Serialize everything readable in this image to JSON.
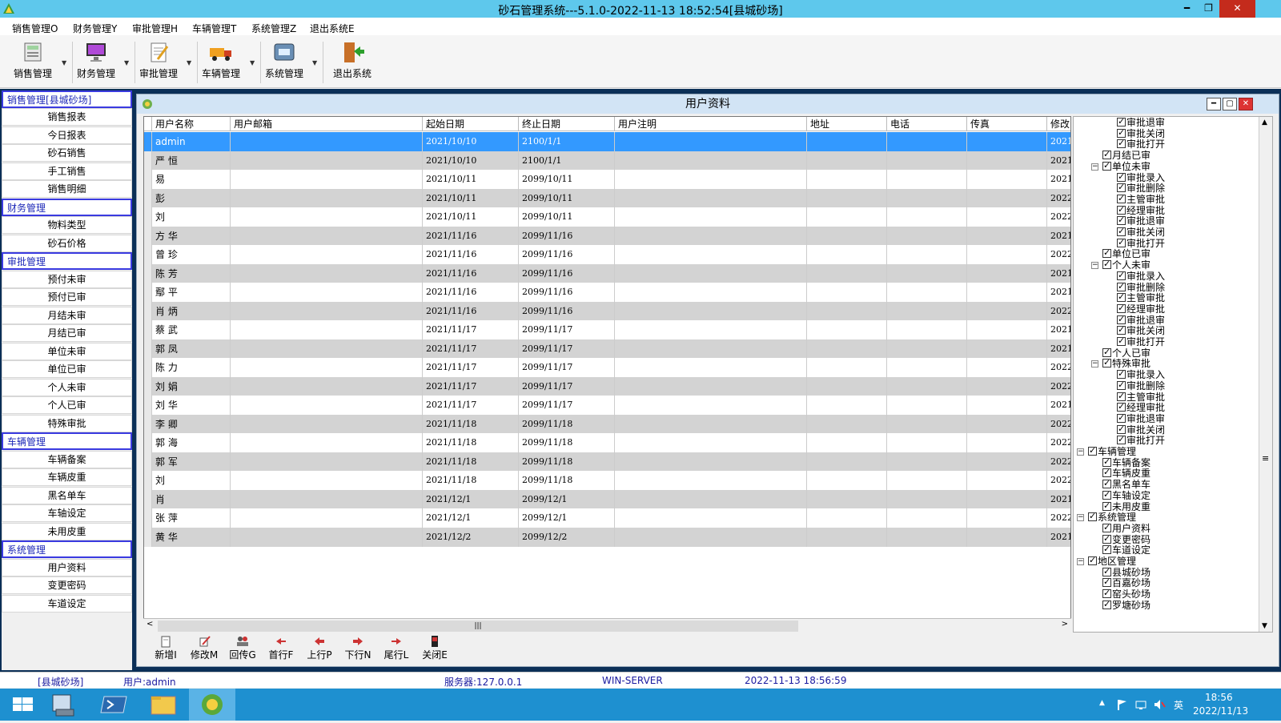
{
  "window": {
    "title": "砂石管理系统---5.1.0-2022-11-13 18:52:54[县城砂场]",
    "min": "━",
    "restore": "❐",
    "close": "✕"
  },
  "menu": [
    "销售管理O",
    "财务管理Y",
    "审批管理H",
    "车辆管理T",
    "系统管理Z",
    "退出系统E"
  ],
  "toolbar": [
    "销售管理",
    "财务管理",
    "审批管理",
    "车辆管理",
    "系统管理",
    "退出系统"
  ],
  "sidebar": [
    {
      "header": "销售管理[县城砂场]",
      "items": [
        "销售报表",
        "今日报表",
        "砂石销售",
        "手工销售",
        "销售明细"
      ]
    },
    {
      "header": "财务管理",
      "items": [
        "物料类型",
        "砂石价格"
      ]
    },
    {
      "header": "审批管理",
      "items": [
        "预付未审",
        "预付已审",
        "月结未审",
        "月结已审",
        "单位未审",
        "单位已审",
        "个人未审",
        "个人已审",
        "特殊审批"
      ]
    },
    {
      "header": "车辆管理",
      "items": [
        "车辆备案",
        "车辆皮重",
        "黑名单车",
        "车轴设定",
        "未用皮重"
      ]
    },
    {
      "header": "系统管理",
      "items": [
        "用户资料",
        "变更密码",
        "车道设定"
      ]
    }
  ],
  "child_window": {
    "title": "用户资料"
  },
  "grid": {
    "columns": [
      "用户名称",
      "用户邮箱",
      "起始日期",
      "终止日期",
      "用户注明",
      "地址",
      "电话",
      "传真",
      "修改"
    ],
    "rows": [
      [
        "admin",
        "",
        "2021/10/10",
        "2100/1/1",
        "2021"
      ],
      [
        "严  恒",
        "",
        "2021/10/10",
        "2100/1/1",
        "2021"
      ],
      [
        "易",
        "",
        "2021/10/11",
        "2099/10/11",
        "2021"
      ],
      [
        "彭",
        "",
        "2021/10/11",
        "2099/10/11",
        "2022"
      ],
      [
        "刘",
        "",
        "2021/10/11",
        "2099/10/11",
        "2022"
      ],
      [
        "方  华",
        "",
        "2021/11/16",
        "2099/11/16",
        "2021"
      ],
      [
        "曾  珍",
        "",
        "2021/11/16",
        "2099/11/16",
        "2022"
      ],
      [
        "陈  芳",
        "",
        "2021/11/16",
        "2099/11/16",
        "2021"
      ],
      [
        "鄢  平",
        "",
        "2021/11/16",
        "2099/11/16",
        "2021"
      ],
      [
        "肖  炳",
        "",
        "2021/11/16",
        "2099/11/16",
        "2022"
      ],
      [
        "蔡  武",
        "",
        "2021/11/17",
        "2099/11/17",
        "2021"
      ],
      [
        "郭  凤",
        "",
        "2021/11/17",
        "2099/11/17",
        "2021"
      ],
      [
        "陈  力",
        "",
        "2021/11/17",
        "2099/11/17",
        "2022"
      ],
      [
        "刘  娟",
        "",
        "2021/11/17",
        "2099/11/17",
        "2022"
      ],
      [
        "刘  华",
        "",
        "2021/11/17",
        "2099/11/17",
        "2021"
      ],
      [
        "李  卿",
        "",
        "2021/11/18",
        "2099/11/18",
        "2022"
      ],
      [
        "郭  海",
        "",
        "2021/11/18",
        "2099/11/18",
        "2022"
      ],
      [
        "郭  军",
        "",
        "2021/11/18",
        "2099/11/18",
        "2022"
      ],
      [
        "刘",
        "",
        "2021/11/18",
        "2099/11/18",
        "2022"
      ],
      [
        "肖",
        "",
        "2021/12/1",
        "2099/12/1",
        "2021"
      ],
      [
        "张  萍",
        "",
        "2021/12/1",
        "2099/12/1",
        "2022"
      ],
      [
        "黄  华",
        "",
        "2021/12/2",
        "2099/12/2",
        "2021"
      ]
    ],
    "selected_row": 0,
    "hscroll_thumb": "|||"
  },
  "tree": [
    {
      "level": 2,
      "label": "审批退审"
    },
    {
      "level": 2,
      "label": "审批关闭"
    },
    {
      "level": 2,
      "label": "审批打开"
    },
    {
      "level": 1,
      "label": "月结已审"
    },
    {
      "level": 1,
      "label": "单位未审",
      "expander": "−"
    },
    {
      "level": 2,
      "label": "审批录入"
    },
    {
      "level": 2,
      "label": "审批删除"
    },
    {
      "level": 2,
      "label": "主管审批"
    },
    {
      "level": 2,
      "label": "经理审批"
    },
    {
      "level": 2,
      "label": "审批退审"
    },
    {
      "level": 2,
      "label": "审批关闭"
    },
    {
      "level": 2,
      "label": "审批打开"
    },
    {
      "level": 1,
      "label": "单位已审"
    },
    {
      "level": 1,
      "label": "个人未审",
      "expander": "−"
    },
    {
      "level": 2,
      "label": "审批录入"
    },
    {
      "level": 2,
      "label": "审批删除"
    },
    {
      "level": 2,
      "label": "主管审批"
    },
    {
      "level": 2,
      "label": "经理审批"
    },
    {
      "level": 2,
      "label": "审批退审"
    },
    {
      "level": 2,
      "label": "审批关闭"
    },
    {
      "level": 2,
      "label": "审批打开"
    },
    {
      "level": 1,
      "label": "个人已审"
    },
    {
      "level": 1,
      "label": "特殊审批",
      "expander": "−"
    },
    {
      "level": 2,
      "label": "审批录入"
    },
    {
      "level": 2,
      "label": "审批删除"
    },
    {
      "level": 2,
      "label": "主管审批"
    },
    {
      "level": 2,
      "label": "经理审批"
    },
    {
      "level": 2,
      "label": "审批退审"
    },
    {
      "level": 2,
      "label": "审批关闭"
    },
    {
      "level": 2,
      "label": "审批打开"
    },
    {
      "level": 0,
      "label": "车辆管理",
      "expander": "−"
    },
    {
      "level": 1,
      "label": "车辆备案"
    },
    {
      "level": 1,
      "label": "车辆皮重"
    },
    {
      "level": 1,
      "label": "黑名单车"
    },
    {
      "level": 1,
      "label": "车轴设定"
    },
    {
      "level": 1,
      "label": "未用皮重"
    },
    {
      "level": 0,
      "label": "系统管理",
      "expander": "−"
    },
    {
      "level": 1,
      "label": "用户资料"
    },
    {
      "level": 1,
      "label": "变更密码"
    },
    {
      "level": 1,
      "label": "车道设定"
    },
    {
      "level": 0,
      "label": "地区管理",
      "expander": "−"
    },
    {
      "level": 1,
      "label": "县城砂场"
    },
    {
      "level": 1,
      "label": "百嘉砂场"
    },
    {
      "level": 1,
      "label": "窑头砂场"
    },
    {
      "level": 1,
      "label": "罗塘砂场"
    }
  ],
  "tree_scroll_mark": "≡",
  "bottom_buttons": [
    "新增I",
    "修改M",
    "回传G",
    "首行F",
    "上行P",
    "下行N",
    "尾行L",
    "关闭E"
  ],
  "status": {
    "site": "[县城砂场]",
    "user": "用户:admin",
    "server": "服务器:127.0.0.1",
    "host": "WIN-SERVER",
    "time": "2022-11-13 18:56:59"
  },
  "taskbar": {
    "clock_time": "18:56",
    "clock_date": "2022/11/13",
    "ime": "英",
    "tray_arrow": "▲"
  },
  "colors": {
    "title_bar": "#5ec8ec",
    "workspace": "#0b2f57",
    "selected_row": "#3399ff",
    "alt_row": "#d3d3d3",
    "taskbar": "#1e90d0"
  }
}
